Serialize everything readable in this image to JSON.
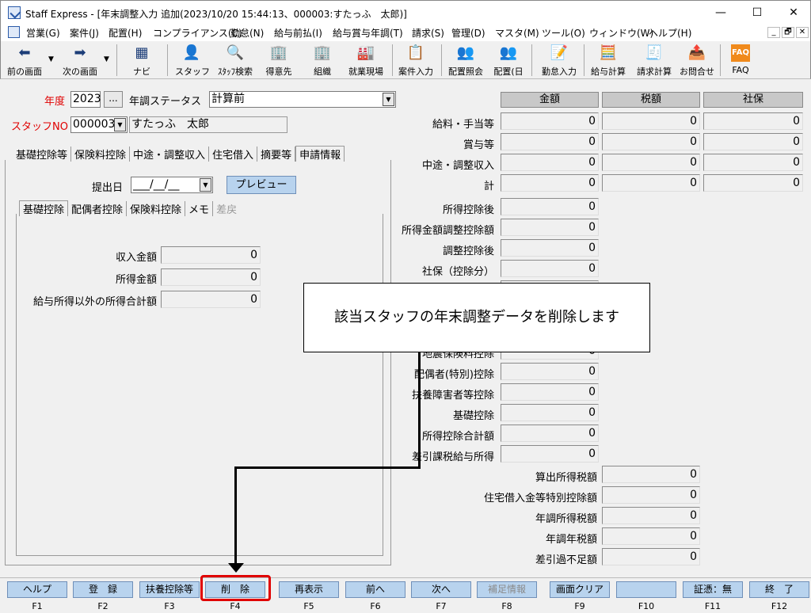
{
  "window": {
    "title": "Staff Express - [年末調整入力 追加(2023/10/20 15:44:13、000003:すたっふ　太郎)]",
    "min": "—",
    "max": "☐",
    "close": "✕"
  },
  "menu": [
    "営業(G)",
    "案件(J)",
    "配置(H)",
    "コンプライアンス(C)",
    "勤怠(N)",
    "給与前払(I)",
    "給与賞与年調(T)",
    "請求(S)",
    "管理(D)",
    "マスタ(M)",
    "ツール(O)",
    "ウィンドウ(W)",
    "ヘルプ(H)"
  ],
  "mdi": [
    "_",
    "🗗",
    "✕"
  ],
  "toolbar": [
    {
      "label": "前の画面",
      "icon": "back-arrow-icon",
      "glyph": "⬅"
    },
    {
      "label": "次の画面",
      "icon": "forward-arrow-icon",
      "glyph": "➡"
    },
    {
      "label": "ナビ",
      "icon": "navi-icon",
      "glyph": "▦"
    },
    {
      "label": "スタッフ",
      "icon": "staff-icon",
      "glyph": "👤"
    },
    {
      "label": "ｽﾀｯﾌ検索",
      "icon": "staff-search-icon",
      "glyph": "🔍"
    },
    {
      "label": "得意先",
      "icon": "client-icon",
      "glyph": "🏢"
    },
    {
      "label": "組織",
      "icon": "organization-icon",
      "glyph": "🏢"
    },
    {
      "label": "就業現場",
      "icon": "worksite-icon",
      "glyph": "🏭"
    },
    {
      "label": "案件入力",
      "icon": "job-input-icon",
      "glyph": "📋"
    },
    {
      "label": "配置照会",
      "icon": "assignment-query-icon",
      "glyph": "👥"
    },
    {
      "label": "配置(日",
      "icon": "assignment-daily-icon",
      "glyph": "👥"
    },
    {
      "label": "勤怠入力",
      "icon": "attendance-input-icon",
      "glyph": "📝"
    },
    {
      "label": "給与計算",
      "icon": "payroll-calc-icon",
      "glyph": "🧮"
    },
    {
      "label": "請求計算",
      "icon": "billing-calc-icon",
      "glyph": "🧾"
    },
    {
      "label": "お問合せ",
      "icon": "inquiry-icon",
      "glyph": "📤"
    },
    {
      "label": "FAQ",
      "icon": "faq-icon",
      "glyph": "FAQ"
    }
  ],
  "form": {
    "year_label": "年度",
    "year": "2023",
    "ellipsis": "...",
    "status_label": "年調ステータス",
    "status": "計算前",
    "staff_label": "スタッフNO",
    "staff_no": "000003",
    "staff_name": "すたっふ　太郎",
    "tabs": [
      "基礎控除等",
      "保険料控除",
      "中途・調整収入",
      "住宅借入",
      "摘要等",
      "申請情報"
    ],
    "submit_label": "提出日",
    "submit_date": "___/__/__",
    "preview": "プレビュー",
    "subtabs": [
      "基礎控除",
      "配偶者控除",
      "保険料控除",
      "メモ",
      "差戻"
    ],
    "income_rows": [
      {
        "label": "収入金額",
        "value": "0"
      },
      {
        "label": "所得金額",
        "value": "0"
      },
      {
        "label": "給与所得以外の所得合計額",
        "value": "0"
      }
    ]
  },
  "summary": {
    "headers": [
      "金額",
      "税額",
      "社保"
    ],
    "rows3": [
      {
        "label": "給料・手当等",
        "values": [
          "0",
          "0",
          "0"
        ]
      },
      {
        "label": "賞与等",
        "values": [
          "0",
          "0",
          "0"
        ]
      },
      {
        "label": "中途・調整収入",
        "values": [
          "0",
          "0",
          "0"
        ]
      },
      {
        "label": "計",
        "values": [
          "0",
          "0",
          "0"
        ]
      }
    ],
    "rows1": [
      {
        "label": "所得控除後",
        "value": "0"
      },
      {
        "label": "所得金額調整控除額",
        "value": "0"
      },
      {
        "label": "調整控除後",
        "value": "0"
      },
      {
        "label": "社保（控除分）",
        "value": "0"
      },
      {
        "label": "",
        "value": "0"
      },
      {
        "label": "",
        "value": "0"
      },
      {
        "label": "",
        "value": "0"
      },
      {
        "label": "地震保険料控除",
        "value": "0"
      },
      {
        "label": "配偶者(特別)控除",
        "value": "0"
      },
      {
        "label": "扶養障害者等控除",
        "value": "0"
      },
      {
        "label": "基礎控除",
        "value": "0"
      },
      {
        "label": "所得控除合計額",
        "value": "0"
      },
      {
        "label": "差引課税給与所得",
        "value": "0"
      }
    ],
    "tax_rows": [
      {
        "label": "算出所得税額",
        "value": "0"
      },
      {
        "label": "住宅借入金等特別控除額",
        "value": "0"
      },
      {
        "label": "年調所得税額",
        "value": "0"
      },
      {
        "label": "年調年税額",
        "value": "0"
      },
      {
        "label": "差引過不足額",
        "value": "0"
      }
    ]
  },
  "callout": "該当スタッフの年末調整データを削除します",
  "fkeys": [
    {
      "label": "ヘルプ",
      "key": "F1",
      "enabled": true
    },
    {
      "label": "登　録",
      "key": "F2",
      "enabled": true
    },
    {
      "label": "扶養控除等",
      "key": "F3",
      "enabled": true
    },
    {
      "label": "削　除",
      "key": "F4",
      "enabled": true
    },
    {
      "label": "再表示",
      "key": "F5",
      "enabled": true
    },
    {
      "label": "前へ",
      "key": "F6",
      "enabled": true
    },
    {
      "label": "次へ",
      "key": "F7",
      "enabled": true
    },
    {
      "label": "補足情報",
      "key": "F8",
      "enabled": false
    },
    {
      "label": "画面クリア",
      "key": "F9",
      "enabled": true
    },
    {
      "label": "",
      "key": "F10",
      "enabled": true
    },
    {
      "label": "証憑：無",
      "key": "F11",
      "enabled": true
    },
    {
      "label": "終　了",
      "key": "F12",
      "enabled": true
    }
  ]
}
